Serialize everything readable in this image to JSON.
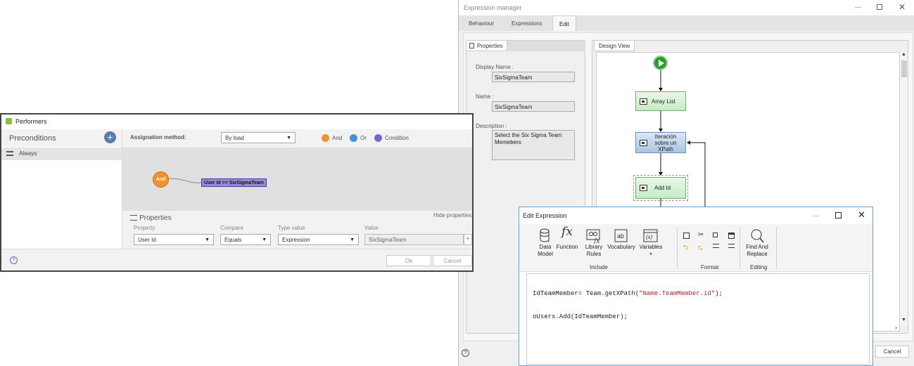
{
  "expression_manager": {
    "title": "Expression manager",
    "tabs": [
      "Behaviour",
      "Expressions",
      "Edit"
    ],
    "active_tab": "Edit",
    "properties_tab": "Properties",
    "display_name_label": "Display Name :",
    "display_name_value": "SixSigmaTeam",
    "name_label": "Name :",
    "name_value": "SixSigmaTeam",
    "description_label": "Description :",
    "description_value": "Select the Six Sigma Team Memebers",
    "design_view_tab": "Design View",
    "nodes": {
      "array_list": "Array List",
      "iteration": "Iteración sobre un XPath",
      "add_id": "Add Id"
    },
    "cancel_label": "Cancel"
  },
  "edit_expression": {
    "title": "Edit Expression",
    "ribbon": {
      "data_model": "Data Model",
      "function": "Function",
      "library_rules": "Library Rules",
      "vocabulary": "Vocabulary",
      "variables": "Variables",
      "include_group": "Include",
      "format_group": "Format",
      "find_replace": "Find And Replace",
      "editing_group": "Editing"
    },
    "code_line1_prefix": "IdTeamMember= Team.getXPath(",
    "code_line1_string": "\"Name.TeamMember.id\"",
    "code_line1_suffix": ");",
    "code_line2": "oUsers.Add(IdTeamMember);"
  },
  "performers": {
    "title": "Performers",
    "preconditions_label": "Preconditions",
    "always_label": "Always",
    "assignation_label": "Assignation method:",
    "assignation_value": "By load",
    "legend": {
      "and": "And",
      "or": "Or",
      "condition": "Condition",
      "and_color": "#f0922e",
      "or_color": "#4a90d9",
      "condition_color": "#7b68c8"
    },
    "and_node": "And",
    "condition_node": "User Id == SixSigmaTeam",
    "properties_label": "Properties",
    "hide_properties": "Hide properties",
    "col_property": "Property",
    "col_compare": "Compare",
    "col_type_value": "Type value",
    "col_value": "Value",
    "property_value": "User Id",
    "compare_value": "Equals",
    "type_value": "Expression",
    "value_value": "SixSigmaTeam",
    "ok_label": "Ok",
    "cancel_label": "Cancel"
  }
}
